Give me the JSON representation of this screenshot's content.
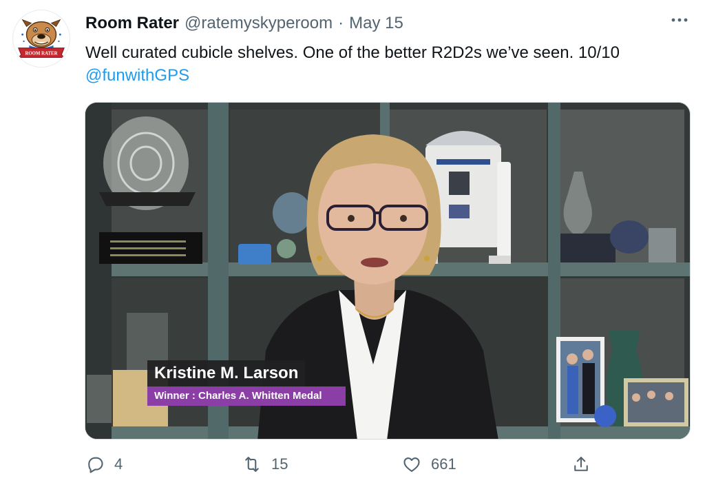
{
  "author": {
    "display_name": "Room Rater",
    "handle": "@ratemyskyperoom",
    "separator": "·",
    "date": "May 15",
    "avatar_icon": "bulldog-mascot-logo",
    "avatar_banner_text": "ROOM RATER"
  },
  "more_icon": "more-dots-icon",
  "tweet": {
    "text": "Well curated cubicle shelves. One of the better R2D2s we’ve seen. 10/10",
    "mention": "@funwithGPS"
  },
  "media": {
    "lower_third": {
      "name": "Kristine M. Larson",
      "subtitle": "Winner : Charles A. Whitten Medal",
      "subtitle_color": "#8b3fa6"
    }
  },
  "actions": {
    "reply": {
      "icon": "reply-icon",
      "count": "4"
    },
    "retweet": {
      "icon": "retweet-icon",
      "count": "15"
    },
    "like": {
      "icon": "heart-icon",
      "count": "661"
    },
    "share": {
      "icon": "share-icon"
    }
  },
  "colors": {
    "link": "#1d9bf0",
    "muted": "#536471",
    "text": "#0f1419"
  }
}
